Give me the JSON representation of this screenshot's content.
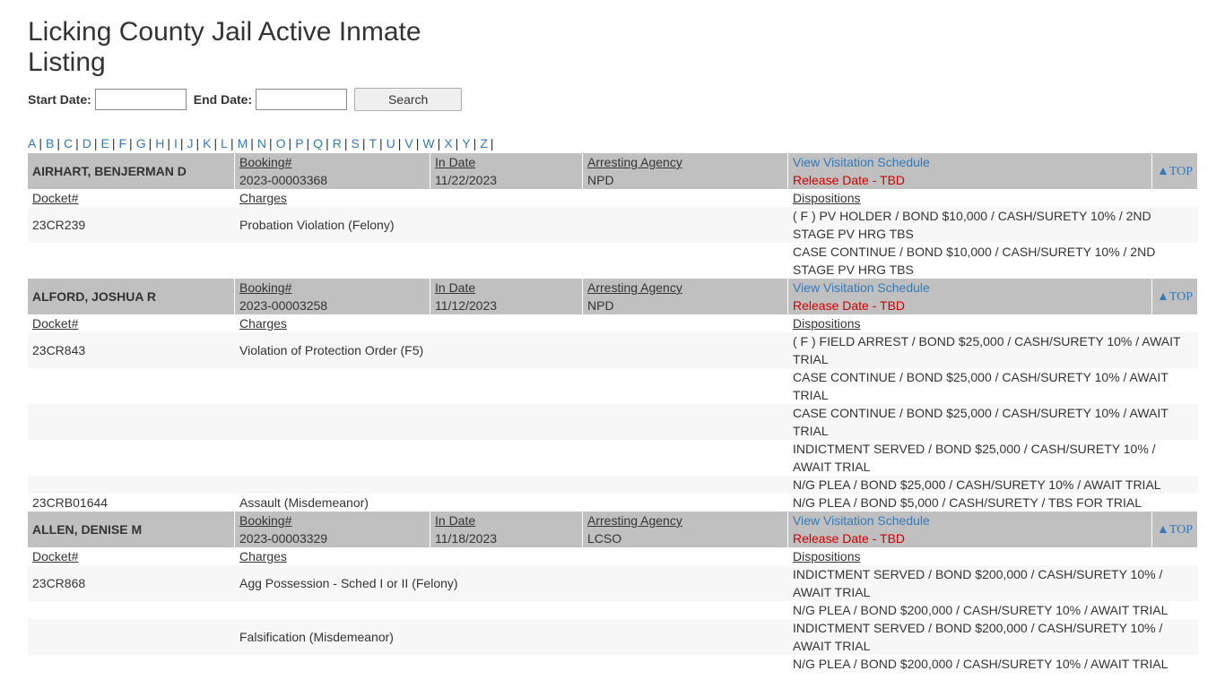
{
  "page": {
    "title": "Licking County Jail Active Inmate Listing"
  },
  "search": {
    "start_label": "Start Date:",
    "end_label": "End Date:",
    "button": "Search",
    "start_value": "",
    "end_value": ""
  },
  "alphabet": [
    "A",
    "B",
    "C",
    "D",
    "E",
    "F",
    "G",
    "H",
    "I",
    "J",
    "K",
    "L",
    "M",
    "N",
    "O",
    "P",
    "Q",
    "R",
    "S",
    "T",
    "U",
    "V",
    "W",
    "X",
    "Y",
    "Z"
  ],
  "labels": {
    "booking": "Booking#",
    "in_date": "In Date",
    "agency": "Arresting Agency",
    "visitation": "View Visitation Schedule",
    "release": "Release Date - TBD",
    "top": "TOP",
    "docket": "Docket#",
    "charges": "Charges",
    "dispositions": "Dispositions"
  },
  "inmates": [
    {
      "name": "AIRHART, BENJERMAN D",
      "booking": "2023-00003368",
      "in_date": "11/22/2023",
      "agency": "NPD",
      "rows": [
        {
          "docket": "23CR239",
          "charge": "Probation Violation (Felony)",
          "disposition": "( F ) PV HOLDER / BOND $10,000 / CASH/SURETY 10% / 2ND STAGE PV HRG TBS"
        },
        {
          "docket": "",
          "charge": "",
          "disposition": "CASE CONTINUE / BOND $10,000 / CASH/SURETY 10% / 2ND STAGE PV HRG TBS"
        }
      ]
    },
    {
      "name": "ALFORD, JOSHUA R",
      "booking": "2023-00003258",
      "in_date": "11/12/2023",
      "agency": "NPD",
      "rows": [
        {
          "docket": "23CR843",
          "charge": "Violation of Protection Order (F5)",
          "disposition": "( F ) FIELD ARREST / BOND $25,000 / CASH/SURETY 10% / AWAIT TRIAL"
        },
        {
          "docket": "",
          "charge": "",
          "disposition": "CASE CONTINUE / BOND $25,000 / CASH/SURETY 10% / AWAIT TRIAL"
        },
        {
          "docket": "",
          "charge": "",
          "disposition": "CASE CONTINUE / BOND $25,000 / CASH/SURETY 10% / AWAIT TRIAL"
        },
        {
          "docket": "",
          "charge": "",
          "disposition": "INDICTMENT SERVED / BOND $25,000 / CASH/SURETY 10% / AWAIT TRIAL"
        },
        {
          "docket": "",
          "charge": "",
          "disposition": "N/G PLEA / BOND $25,000 / CASH/SURETY 10% / AWAIT TRIAL"
        },
        {
          "docket": "23CRB01644",
          "charge": "Assault (Misdemeanor)",
          "disposition": "N/G PLEA / BOND $5,000 / CASH/SURETY / TBS FOR TRIAL"
        }
      ]
    },
    {
      "name": "ALLEN, DENISE M",
      "booking": "2023-00003329",
      "in_date": "11/18/2023",
      "agency": "LCSO",
      "rows": [
        {
          "docket": "23CR868",
          "charge": "Agg Possession - Sched I or II (Felony)",
          "disposition": "INDICTMENT SERVED / BOND $200,000 / CASH/SURETY 10% / AWAIT TRIAL"
        },
        {
          "docket": "",
          "charge": "",
          "disposition": "N/G PLEA / BOND $200,000 / CASH/SURETY 10% / AWAIT TRIAL"
        },
        {
          "docket": "",
          "charge": "Falsification (Misdemeanor)",
          "disposition": "INDICTMENT SERVED / BOND $200,000 / CASH/SURETY 10% / AWAIT TRIAL"
        },
        {
          "docket": "",
          "charge": "",
          "disposition": "N/G PLEA / BOND $200,000 / CASH/SURETY 10% / AWAIT TRIAL"
        }
      ]
    }
  ]
}
